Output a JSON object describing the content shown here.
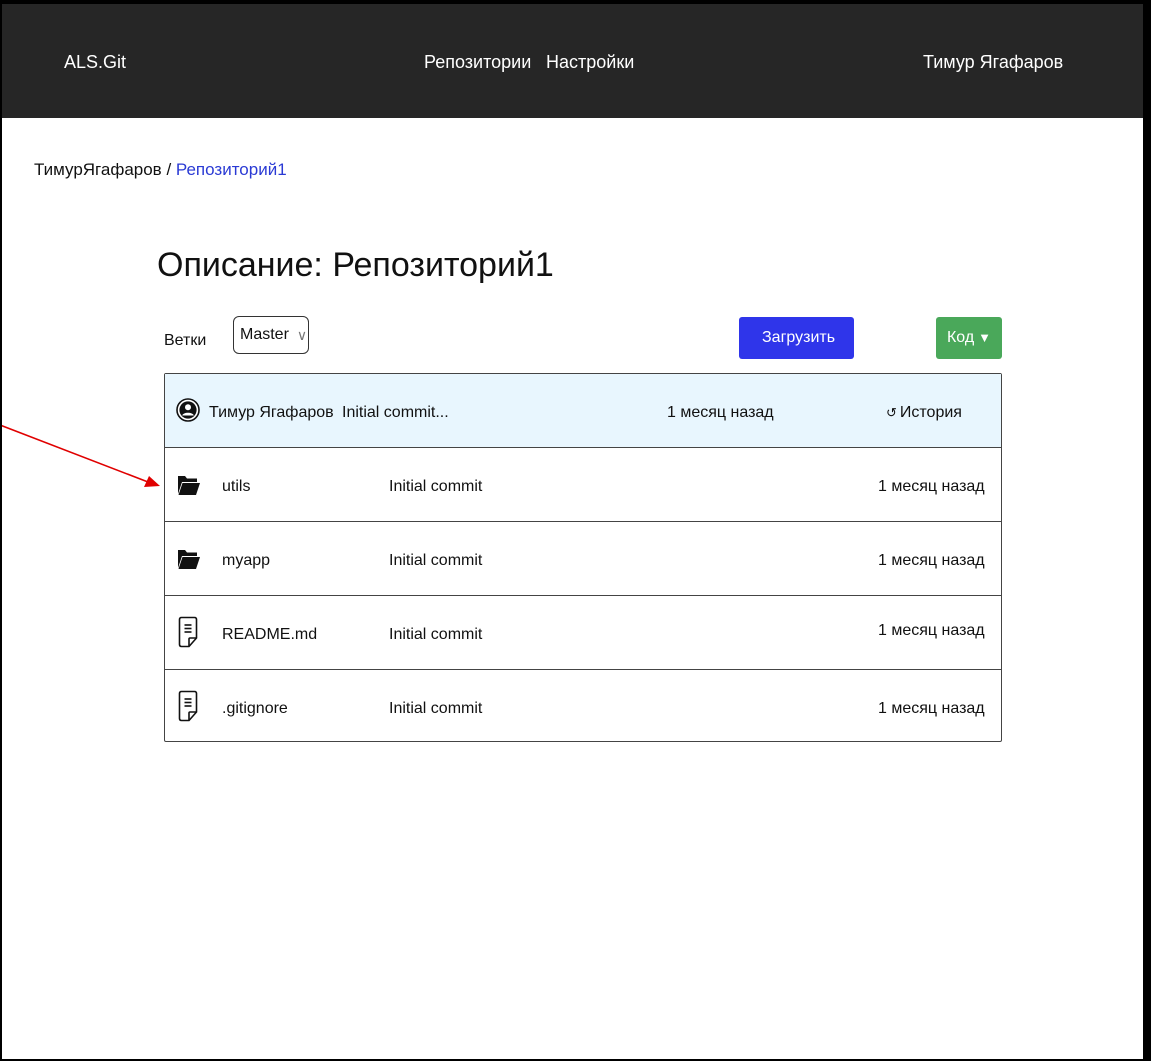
{
  "header": {
    "brand": "ALS.Git",
    "nav": {
      "repositories": "Репозитории",
      "settings": "Настройки"
    },
    "user": "Тимур Ягафаров"
  },
  "breadcrumb": {
    "owner": "ТимурЯгафаров",
    "separator": " / ",
    "repo": "Репозиторий1"
  },
  "page_title": "Описание: Репозиторий1",
  "branch": {
    "label": "Ветки",
    "selected": "Master"
  },
  "buttons": {
    "upload": "Загрузить",
    "code": "Код"
  },
  "latest_commit": {
    "author": "Тимур Ягафаров",
    "message": "Initial commit...",
    "date": "1 месяц назад",
    "history_label": "История"
  },
  "files": [
    {
      "name": "utils",
      "type": "folder",
      "message": "Initial commit",
      "date": "1 месяц назад"
    },
    {
      "name": "myapp",
      "type": "folder",
      "message": "Initial commit",
      "date": "1 месяц назад"
    },
    {
      "name": "README.md",
      "type": "file",
      "message": "Initial commit",
      "date": "1 месяц назад"
    },
    {
      "name": ".gitignore",
      "type": "file",
      "message": "Initial commit",
      "date": "1 месяц назад"
    }
  ],
  "colors": {
    "topbar": "#262626",
    "upload": "#2f35ea",
    "code": "#4aa85a",
    "header_row": "#e8f6fe",
    "link": "#2a3ad4",
    "annotation_arrow": "#e00000"
  }
}
